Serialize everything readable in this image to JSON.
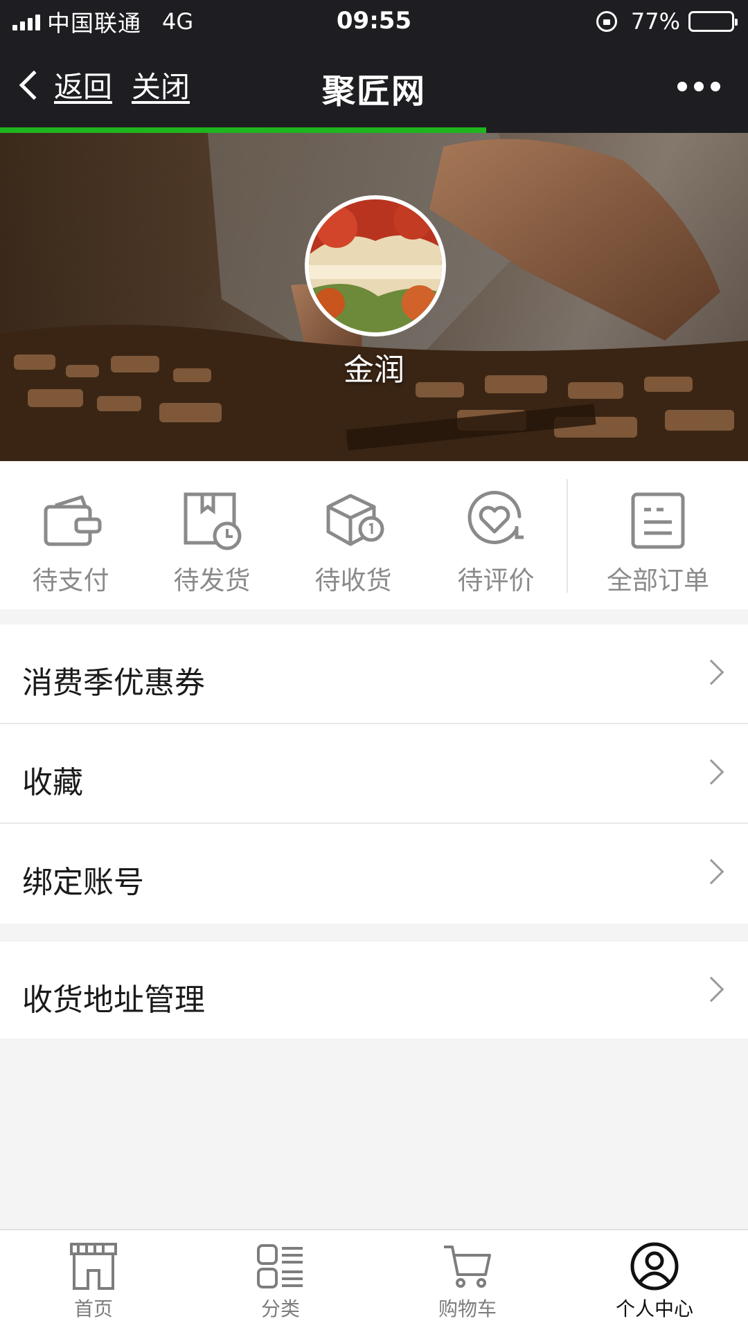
{
  "status_bar": {
    "carrier": "中国联通",
    "network": "4G",
    "time": "09:55",
    "battery": "77%",
    "battery_level": 0.77
  },
  "nav": {
    "back_label": "返回",
    "close_label": "关闭",
    "title": "聚匠网",
    "more_icon": "more-dots-icon"
  },
  "page_load_progress": 0.65,
  "profile": {
    "username": "金润"
  },
  "orders": [
    {
      "label": "待支付",
      "icon": "wallet-icon"
    },
    {
      "label": "待发货",
      "icon": "package-clock-icon"
    },
    {
      "label": "待收货",
      "icon": "box-receive-icon"
    },
    {
      "label": "待评价",
      "icon": "heart-review-icon"
    },
    {
      "label": "全部订单",
      "icon": "order-list-icon"
    }
  ],
  "menu": [
    {
      "label": "消费季优惠券"
    },
    {
      "label": "收藏"
    },
    {
      "label": "绑定账号"
    },
    {
      "label": "收货地址管理"
    }
  ],
  "tabs": [
    {
      "label": "首页",
      "icon": "storefront-icon"
    },
    {
      "label": "分类",
      "icon": "category-list-icon"
    },
    {
      "label": "购物车",
      "icon": "cart-icon"
    },
    {
      "label": "个人中心",
      "icon": "user-icon",
      "active": true
    }
  ],
  "colors": {
    "bar_bg": "#1e1e22",
    "progress": "#1fb51f",
    "page_bg": "#f4f4f4",
    "icon_gray": "#8a8a8a"
  }
}
